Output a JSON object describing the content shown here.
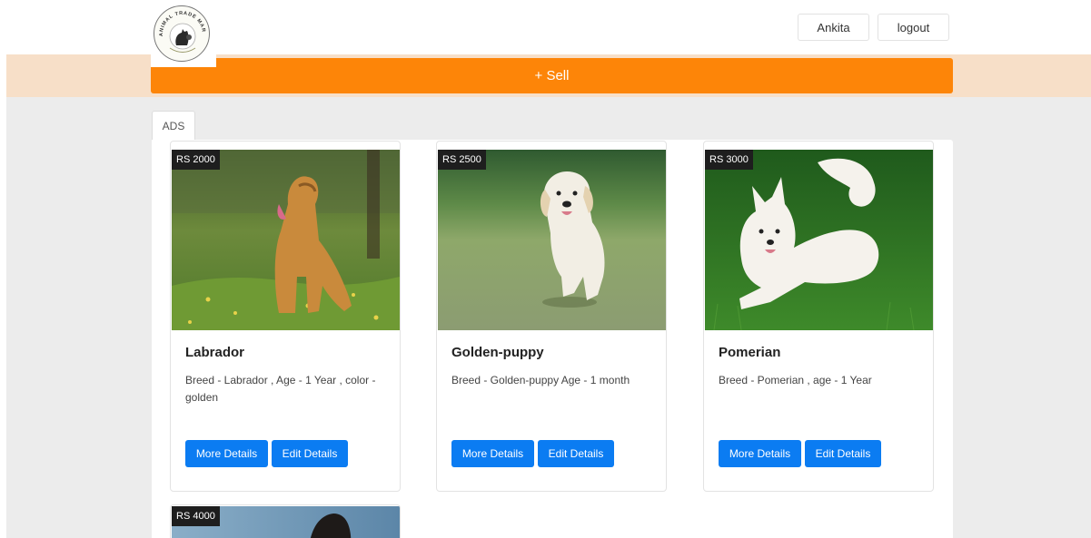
{
  "header": {
    "logo_text_top": "ANIMAL TRADE MART",
    "user_button": "Ankita",
    "logout_button": "logout"
  },
  "sell_button": "+ Sell",
  "tabs": [
    {
      "label": "ADS"
    }
  ],
  "ads": [
    {
      "price": "RS 2000",
      "title": "Labrador",
      "description": "Breed - Labrador , Age - 1 Year , color - golden",
      "more_details": "More Details",
      "edit_details": "Edit Details",
      "image_icon": "labrador-dog-image"
    },
    {
      "price": "RS 2500",
      "title": "Golden-puppy",
      "description": "Breed - Golden-puppy Age - 1 month",
      "more_details": "More Details",
      "edit_details": "Edit Details",
      "image_icon": "golden-puppy-image"
    },
    {
      "price": "RS 3000",
      "title": "Pomerian",
      "description": "Breed - Pomerian , age - 1 Year",
      "more_details": "More Details",
      "edit_details": "Edit Details",
      "image_icon": "pomeranian-dog-image"
    },
    {
      "price": "RS 4000",
      "image_icon": "black-dog-image"
    }
  ],
  "colors": {
    "accent_orange": "#fd8508",
    "button_blue": "#0b7cf2",
    "peach_band": "#f7dfc8",
    "page_background": "#ececec"
  }
}
